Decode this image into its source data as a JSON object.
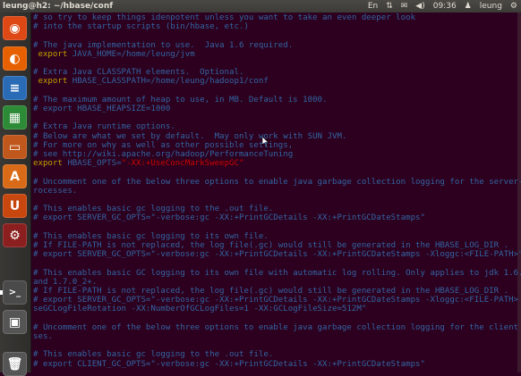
{
  "window": {
    "title": "leung@h2: ~/hbase/conf"
  },
  "tray": {
    "keyboard": "En",
    "time": "09:36",
    "user": "leung"
  },
  "launcher": [
    {
      "name": "dash-home-icon",
      "glyph": "◉",
      "color": "#dd4814"
    },
    {
      "name": "firefox-icon",
      "glyph": "◐",
      "color": "#e66000"
    },
    {
      "name": "libreoffice-writer-icon",
      "glyph": "≡",
      "color": "#2a6bb5"
    },
    {
      "name": "libreoffice-calc-icon",
      "glyph": "▦",
      "color": "#2d8a36"
    },
    {
      "name": "libreoffice-impress-icon",
      "glyph": "▭",
      "color": "#c0571c"
    },
    {
      "name": "software-center-icon",
      "glyph": "A",
      "color": "#d96a18"
    },
    {
      "name": "ubuntu-one-icon",
      "glyph": "U",
      "color": "#c8470e"
    },
    {
      "name": "system-settings-icon",
      "glyph": "⚙",
      "color": "#8b1f1f"
    },
    {
      "name": "terminal-icon",
      "glyph": ">_",
      "color": "#4a4a4a"
    },
    {
      "name": "workspace-switcher-icon",
      "glyph": "▣",
      "color": "#555"
    },
    {
      "name": "trash-icon",
      "glyph": "🗑",
      "color": "#555"
    }
  ],
  "lines": [
    {
      "segments": [
        {
          "t": "# so try to keep things idenpotent unless you want to take an even deeper look",
          "c": "comment"
        }
      ]
    },
    {
      "segments": [
        {
          "t": "# into the startup scripts (bin/hbase, etc.)",
          "c": "comment"
        }
      ]
    },
    {
      "segments": [
        {
          "t": "",
          "c": "comment"
        }
      ]
    },
    {
      "segments": [
        {
          "t": "# The java implementation to use.  Java 1.6 required.",
          "c": "comment"
        }
      ]
    },
    {
      "segments": [
        {
          "t": " export",
          "c": "kw"
        },
        {
          "t": " JAVA_HOME=/home/leung/jvm",
          "c": "comment"
        }
      ]
    },
    {
      "segments": [
        {
          "t": "",
          "c": "comment"
        }
      ]
    },
    {
      "segments": [
        {
          "t": "# Extra Java CLASSPATH elements.  Optional.",
          "c": "comment"
        }
      ]
    },
    {
      "segments": [
        {
          "t": " export",
          "c": "kw"
        },
        {
          "t": " HBASE_CLASSPATH=/home/leung/hadoop1/conf",
          "c": "comment"
        }
      ]
    },
    {
      "segments": [
        {
          "t": "",
          "c": "comment"
        }
      ]
    },
    {
      "segments": [
        {
          "t": "# The maximum amount of heap to use, in MB. Default is 1000.",
          "c": "comment"
        }
      ]
    },
    {
      "segments": [
        {
          "t": "# export HBASE_HEAPSIZE=1000",
          "c": "comment"
        }
      ]
    },
    {
      "segments": [
        {
          "t": "",
          "c": "comment"
        }
      ]
    },
    {
      "segments": [
        {
          "t": "# Extra Java runtime options.",
          "c": "comment"
        }
      ]
    },
    {
      "segments": [
        {
          "t": "# Below are what we set by default.  May only work with SUN JVM.",
          "c": "comment"
        }
      ]
    },
    {
      "segments": [
        {
          "t": "# For more on why as well as other possible settings,",
          "c": "comment"
        }
      ]
    },
    {
      "segments": [
        {
          "t": "# see http://wiki.apache.org/hadoop/PerformanceTuning",
          "c": "comment"
        }
      ]
    },
    {
      "segments": [
        {
          "t": "export",
          "c": "kw"
        },
        {
          "t": " HBASE_OPTS=",
          "c": "comment"
        },
        {
          "t": "\"-XX:+UseConcMarkSweepGC\"",
          "c": "str"
        }
      ]
    },
    {
      "segments": [
        {
          "t": "",
          "c": "comment"
        }
      ]
    },
    {
      "segments": [
        {
          "t": "# Uncomment one of the below three options to enable java garbage collection logging for the server-side p",
          "c": "comment"
        }
      ]
    },
    {
      "segments": [
        {
          "t": "rocesses.",
          "c": "comment"
        }
      ]
    },
    {
      "segments": [
        {
          "t": "",
          "c": "comment"
        }
      ]
    },
    {
      "segments": [
        {
          "t": "# This enables basic gc logging to the .out file.",
          "c": "comment"
        }
      ]
    },
    {
      "segments": [
        {
          "t": "# export SERVER_GC_OPTS=\"-verbose:gc -XX:+PrintGCDetails -XX:+PrintGCDateStamps\"",
          "c": "comment"
        }
      ]
    },
    {
      "segments": [
        {
          "t": "",
          "c": "comment"
        }
      ]
    },
    {
      "segments": [
        {
          "t": "# This enables basic gc logging to its own file.",
          "c": "comment"
        }
      ]
    },
    {
      "segments": [
        {
          "t": "# If FILE-PATH is not replaced, the log file(.gc) would still be generated in the HBASE_LOG_DIR .",
          "c": "comment"
        }
      ]
    },
    {
      "segments": [
        {
          "t": "# export SERVER_GC_OPTS=\"-verbose:gc -XX:+PrintGCDetails -XX:+PrintGCDateStamps -Xloggc:<FILE-PATH>\"",
          "c": "comment"
        }
      ]
    },
    {
      "segments": [
        {
          "t": "",
          "c": "comment"
        }
      ]
    },
    {
      "segments": [
        {
          "t": "# This enables basic GC logging to its own file with automatic log rolling. Only applies to jdk 1.6.0_34+",
          "c": "comment"
        }
      ]
    },
    {
      "segments": [
        {
          "t": "and 1.7.0_2+.",
          "c": "comment"
        }
      ]
    },
    {
      "segments": [
        {
          "t": "# If FILE-PATH is not replaced, the log file(.gc) would still be generated in the HBASE_LOG_DIR .",
          "c": "comment"
        }
      ]
    },
    {
      "segments": [
        {
          "t": "# export SERVER_GC_OPTS=\"-verbose:gc -XX:+PrintGCDetails -XX:+PrintGCDateStamps -Xloggc:<FILE-PATH> -XX:+U",
          "c": "comment"
        }
      ]
    },
    {
      "segments": [
        {
          "t": "seGCLogFileRotation -XX:NumberOfGCLogFiles=1 -XX:GCLogFileSize=512M\"",
          "c": "comment"
        }
      ]
    },
    {
      "segments": [
        {
          "t": "",
          "c": "comment"
        }
      ]
    },
    {
      "segments": [
        {
          "t": "# Uncomment one of the below three options to enable java garbage collection logging for the client proces",
          "c": "comment"
        }
      ]
    },
    {
      "segments": [
        {
          "t": "ses.",
          "c": "comment"
        }
      ]
    },
    {
      "segments": [
        {
          "t": "",
          "c": "comment"
        }
      ]
    },
    {
      "segments": [
        {
          "t": "# This enables basic gc logging to the .out file.",
          "c": "comment"
        }
      ]
    },
    {
      "segments": [
        {
          "t": "# export CLIENT_GC_OPTS=\"-verbose:gc -XX:+PrintGCDetails -XX:+PrintGCDateStamps\"",
          "c": "comment"
        }
      ]
    }
  ]
}
